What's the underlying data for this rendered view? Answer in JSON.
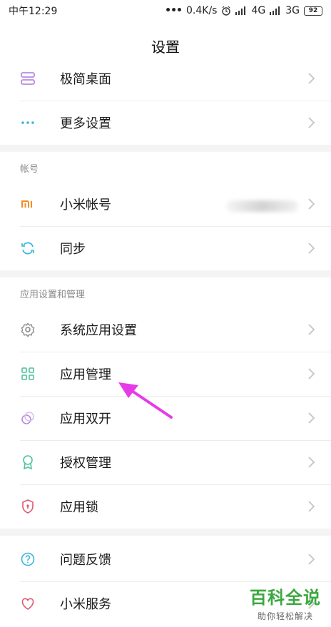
{
  "status_bar": {
    "time": "中午12:29",
    "network_speed": "0.4K/s",
    "net1": "4G",
    "net2": "3G",
    "battery": "92"
  },
  "header": {
    "title": "设置"
  },
  "rows": {
    "minimal_desktop": "极简桌面",
    "more_settings": "更多设置",
    "mi_account": "小米帐号",
    "sync": "同步",
    "system_apps": "系统应用设置",
    "app_management": "应用管理",
    "dual_apps": "应用双开",
    "permissions": "授权管理",
    "app_lock": "应用锁",
    "feedback": "问题反馈",
    "mi_services": "小米服务"
  },
  "sections": {
    "account": "帐号",
    "apps": "应用设置和管理"
  },
  "icons": {
    "minimal_desktop": "layout-icon",
    "more_settings": "more-dots-icon",
    "mi_account": "mi-logo-icon",
    "sync": "sync-icon",
    "system_apps": "gear-icon",
    "app_management": "grid-icon",
    "dual_apps": "dual-circles-icon",
    "permissions": "badge-icon",
    "app_lock": "shield-icon",
    "feedback": "question-icon",
    "mi_services": "heart-icon"
  },
  "watermark": {
    "main": "百科全说",
    "sub": "助你轻松解决"
  },
  "colors": {
    "accent_purple": "#b88ae0",
    "accent_cyan": "#38b7d6",
    "mi_orange": "#f58a1f",
    "arrow_magenta": "#e63ce8",
    "watermark_green": "#3aa83f"
  }
}
